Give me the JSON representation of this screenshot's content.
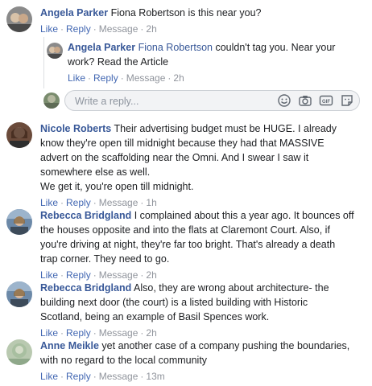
{
  "comments": [
    {
      "author": "Angela Parker",
      "tag": "",
      "text": "Fiona Robertson is this near you?",
      "line2": "",
      "line3": "",
      "line4": "",
      "like": "Like",
      "reply": "Reply",
      "message": "Message",
      "time": "2h"
    },
    {
      "author": "Angela Parker",
      "tag": "Fiona Robertson",
      "text": "couldn't tag you. Near your",
      "line2": "work? Read the Article",
      "line3": "",
      "line4": "",
      "like": "Like",
      "reply": "Reply",
      "message": "Message",
      "time": "2h"
    },
    {
      "author": "Nicole Roberts",
      "tag": "",
      "text": "Their advertising budget must be HUGE. I already",
      "line2": "know they're open till midnight because they had that MASSIVE",
      "line3": "advert on the scaffolding near the Omni. And I swear I saw it",
      "line4": "somewhere else as well.",
      "line5": "We get it, you're open till midnight.",
      "like": "Like",
      "reply": "Reply",
      "message": "Message",
      "time": "1h"
    },
    {
      "author": "Rebecca Bridgland",
      "tag": "",
      "text": "I complained about this a year ago. It bounces off",
      "line2": "the houses opposite and into the flats at Claremont Court. Also, if",
      "line3": "you're driving at night, they're far too bright. That's already a death",
      "line4": "trap corner. They need to go.",
      "like": "Like",
      "reply": "Reply",
      "message": "Message",
      "time": "2h"
    },
    {
      "author": "Rebecca Bridgland",
      "tag": "",
      "text": "Also, they are wrong about architecture- the",
      "line2": "building next door (the court) is a listed building with Historic",
      "line3": "Scotland, being an example of Basil Spences work.",
      "line4": "",
      "like": "Like",
      "reply": "Reply",
      "message": "Message",
      "time": "2h"
    },
    {
      "author": "Anne Meikle",
      "tag": "",
      "text": "yet another case of a company pushing the boundaries,",
      "line2": "with no regard to the local community",
      "line3": "",
      "line4": "",
      "like": "Like",
      "reply": "Reply",
      "message": "Message",
      "time": "13m"
    }
  ],
  "reply_box": {
    "placeholder": "Write a reply...",
    "icons": [
      "emoji-icon",
      "camera-icon",
      "gif-icon",
      "sticker-icon"
    ]
  },
  "colors": {
    "link": "#385898",
    "action": "#4267b2",
    "meta": "#90949c",
    "input_bg": "#f2f3f5"
  }
}
